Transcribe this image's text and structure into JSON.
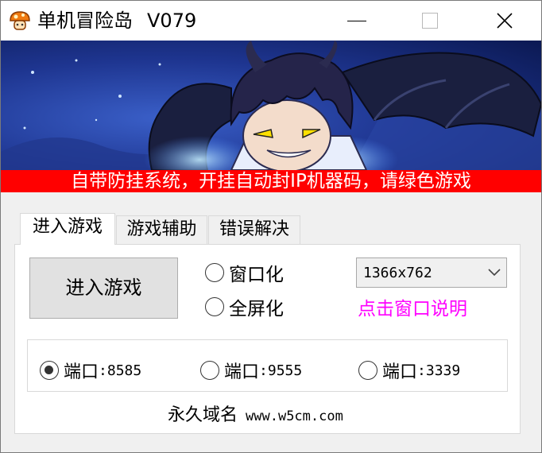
{
  "window": {
    "title": "单机冒险岛",
    "version": "V079"
  },
  "banner": {
    "notice": "自带防挂系统，开挂自动封IP机器码，请绿色游戏"
  },
  "tabs": [
    {
      "label": "进入游戏",
      "active": true
    },
    {
      "label": "游戏辅助",
      "active": false
    },
    {
      "label": "错误解决",
      "active": false
    }
  ],
  "main": {
    "enter_button": "进入游戏",
    "display_modes": [
      {
        "label": "窗口化",
        "checked": false
      },
      {
        "label": "全屏化",
        "checked": false
      }
    ],
    "resolution": "1366x762",
    "window_help_link": "点击窗口说明",
    "ports": [
      {
        "label": "端口",
        "number": ":8585",
        "checked": true
      },
      {
        "label": "端口",
        "number": ":9555",
        "checked": false
      },
      {
        "label": "端口",
        "number": ":3339",
        "checked": false
      }
    ],
    "domain_label": "永久域名",
    "domain_url": "www.w5cm.com"
  },
  "colors": {
    "notice_bar": "#ff0000",
    "link": "#ff00ff",
    "banner_bg": "#1a2d75"
  },
  "icons": [
    "mushroom-app-icon",
    "minimize-icon",
    "maximize-icon",
    "close-icon",
    "chevron-down-icon"
  ]
}
